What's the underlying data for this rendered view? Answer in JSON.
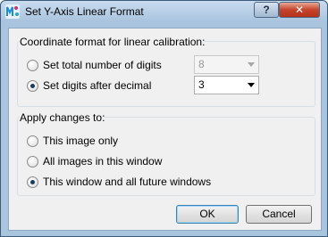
{
  "window": {
    "title": "Set Y-Axis Linear Format",
    "help_glyph": "?",
    "close_glyph": "✕"
  },
  "group1": {
    "label": "Coordinate format for linear calibration:",
    "option_total_digits": "Set total number of digits",
    "option_digits_after_decimal": "Set digits after decimal",
    "selected": "option_digits_after_decimal",
    "total_digits_value": "8",
    "decimal_digits_value": "3"
  },
  "group2": {
    "label": "Apply changes to:",
    "option_this_image": "This image only",
    "option_all_images": "All images in this window",
    "option_future_windows": "This window and all future windows",
    "selected": "option_future_windows"
  },
  "buttons": {
    "ok": "OK",
    "cancel": "Cancel"
  }
}
